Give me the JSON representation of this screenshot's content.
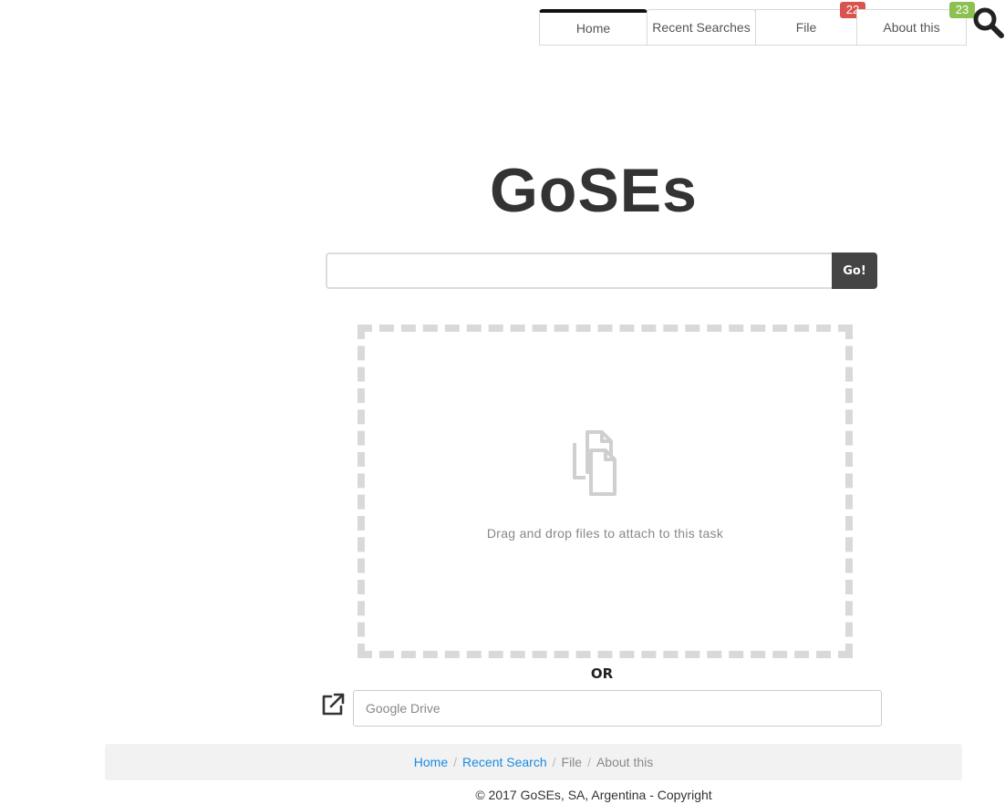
{
  "tabs": [
    {
      "label": "Home"
    },
    {
      "label": "Recent Searches"
    },
    {
      "label": "File",
      "badge": "22"
    },
    {
      "label": "About this",
      "badge": "23"
    }
  ],
  "logo": {
    "text": "GoSEs"
  },
  "search": {
    "value": "",
    "button_label": "Go!"
  },
  "dropzone": {
    "text": "Drag and drop files to attach to this task",
    "icon": "files-icon"
  },
  "or_label": "OR",
  "drive": {
    "placeholder": "Google Drive",
    "icon": "external-link-icon"
  },
  "breadcrumb": {
    "items": [
      "Home",
      "Recent Search",
      "File",
      "About this"
    ],
    "separator": "/"
  },
  "footer": {
    "text": "© 2017 GoSEs, SA, Argentina - Copyright"
  },
  "colors": {
    "badge_red": "#d9534f",
    "badge_green": "#8cc152",
    "link_blue": "#1a8be0",
    "go_button": "#444444"
  }
}
